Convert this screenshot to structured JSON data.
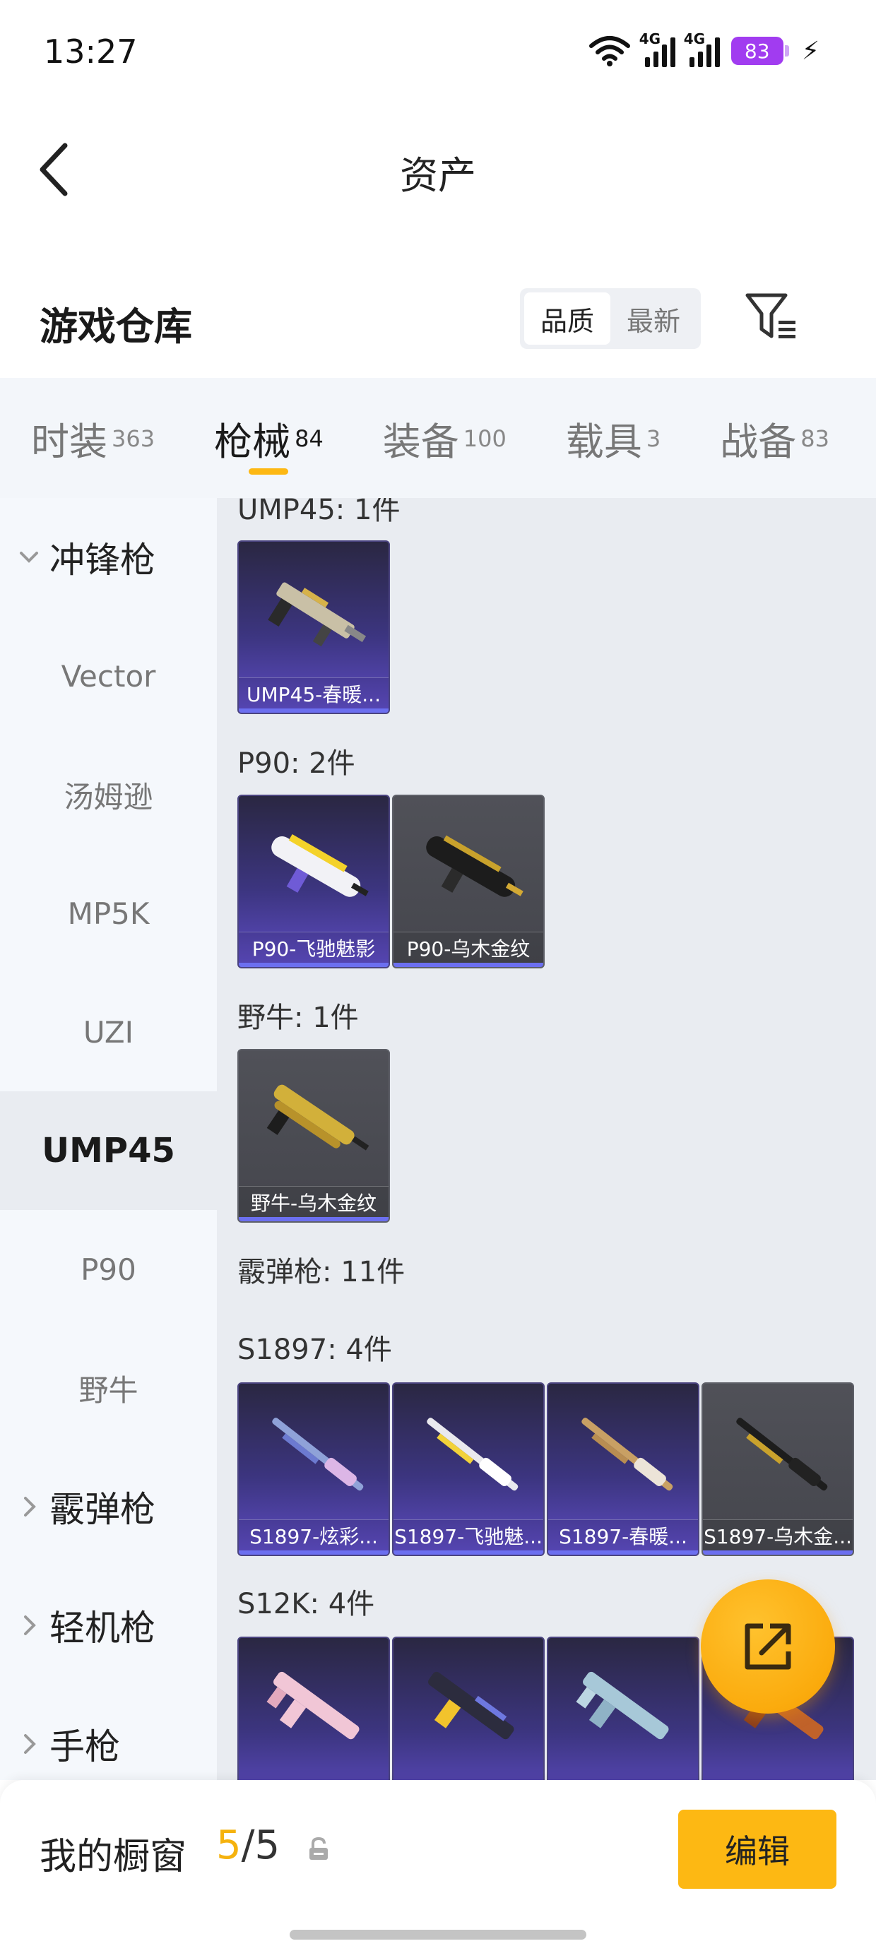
{
  "status_bar": {
    "time": "13:27",
    "net1": "4G",
    "net2": "4G",
    "battery": "83"
  },
  "header": {
    "title": "资产"
  },
  "warehouse": {
    "title": "游戏仓库",
    "sort_options": [
      {
        "label": "品质",
        "active": true
      },
      {
        "label": "最新",
        "active": false
      }
    ]
  },
  "tabs": [
    {
      "label": "时装",
      "count": "363",
      "active": false
    },
    {
      "label": "枪械",
      "count": "84",
      "active": true
    },
    {
      "label": "装备",
      "count": "100",
      "active": false
    },
    {
      "label": "载具",
      "count": "3",
      "active": false
    },
    {
      "label": "战备",
      "count": "83",
      "active": false
    }
  ],
  "sidebar": {
    "group_open": "冲锋枪",
    "items": [
      "Vector",
      "汤姆逊",
      "MP5K",
      "UZI",
      "UMP45",
      "P90",
      "野牛"
    ],
    "selected": "UMP45",
    "groups_closed": [
      "霰弹枪",
      "轻机枪",
      "手枪"
    ]
  },
  "content": {
    "sections": [
      {
        "title": "UMP45: 1件",
        "cards": [
          {
            "name": "UMP45-春暖...",
            "tier": "purple"
          }
        ]
      },
      {
        "title": "P90: 2件",
        "cards": [
          {
            "name": "P90-飞驰魅影",
            "tier": "purple"
          },
          {
            "name": "P90-乌木金纹",
            "tier": "gray"
          }
        ]
      },
      {
        "title": "野牛: 1件",
        "cards": [
          {
            "name": "野牛-乌木金纹",
            "tier": "gray"
          }
        ]
      },
      {
        "title": "霰弹枪: 11件",
        "cards": []
      },
      {
        "title": "S1897: 4件",
        "cards": [
          {
            "name": "S1897-炫彩...",
            "tier": "purple"
          },
          {
            "name": "S1897-飞驰魅...",
            "tier": "purple"
          },
          {
            "name": "S1897-春暖...",
            "tier": "purple"
          },
          {
            "name": "S1897-乌木金...",
            "tier": "gray"
          }
        ]
      },
      {
        "title": "S12K: 4件",
        "cards": []
      }
    ]
  },
  "bottom_bar": {
    "label": "我的橱窗",
    "current": "5",
    "total": "/5",
    "edit_label": "编辑"
  },
  "colors": {
    "accent": "#fdb813",
    "purple_tier": "#5e4cc3",
    "gray_tier": "#505158"
  }
}
